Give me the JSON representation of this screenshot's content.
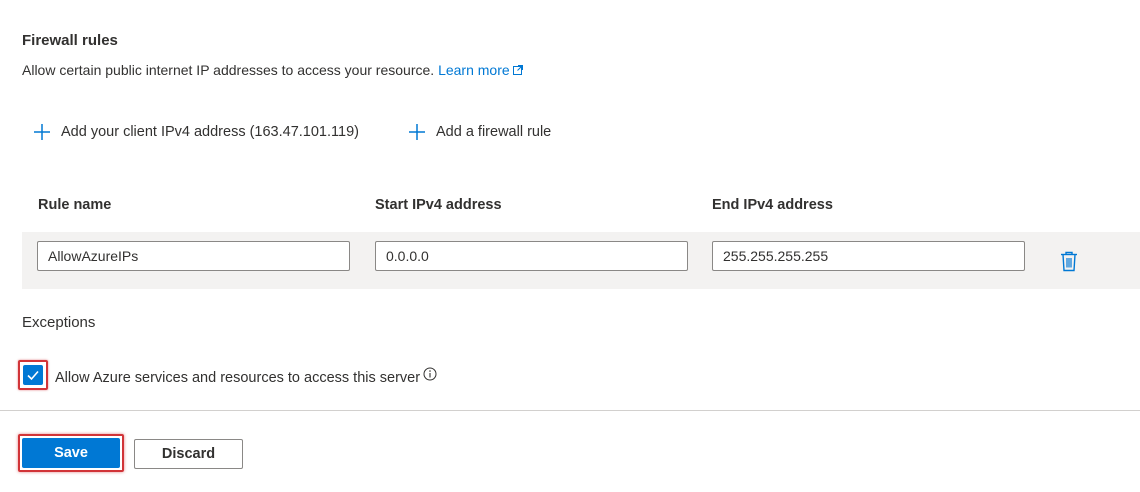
{
  "firewall": {
    "title": "Firewall rules",
    "description": "Allow certain public internet IP addresses to access your resource.",
    "learn_more": "Learn more"
  },
  "commands": {
    "add_client_ip": "Add your client IPv4 address (163.47.101.119)",
    "add_rule": "Add a firewall rule"
  },
  "table": {
    "headers": [
      "Rule name",
      "Start IPv4 address",
      "End IPv4 address"
    ],
    "rows": [
      {
        "rule_name": "AllowAzureIPs",
        "start_ip": "0.0.0.0",
        "end_ip": "255.255.255.255"
      }
    ]
  },
  "exceptions": {
    "title": "Exceptions",
    "allow_azure_label": "Allow Azure services and resources to access this server",
    "allow_azure_checked": true
  },
  "footer": {
    "save_label": "Save",
    "discard_label": "Discard"
  },
  "colors": {
    "accent": "#0078d4",
    "highlight": "#d13438"
  }
}
